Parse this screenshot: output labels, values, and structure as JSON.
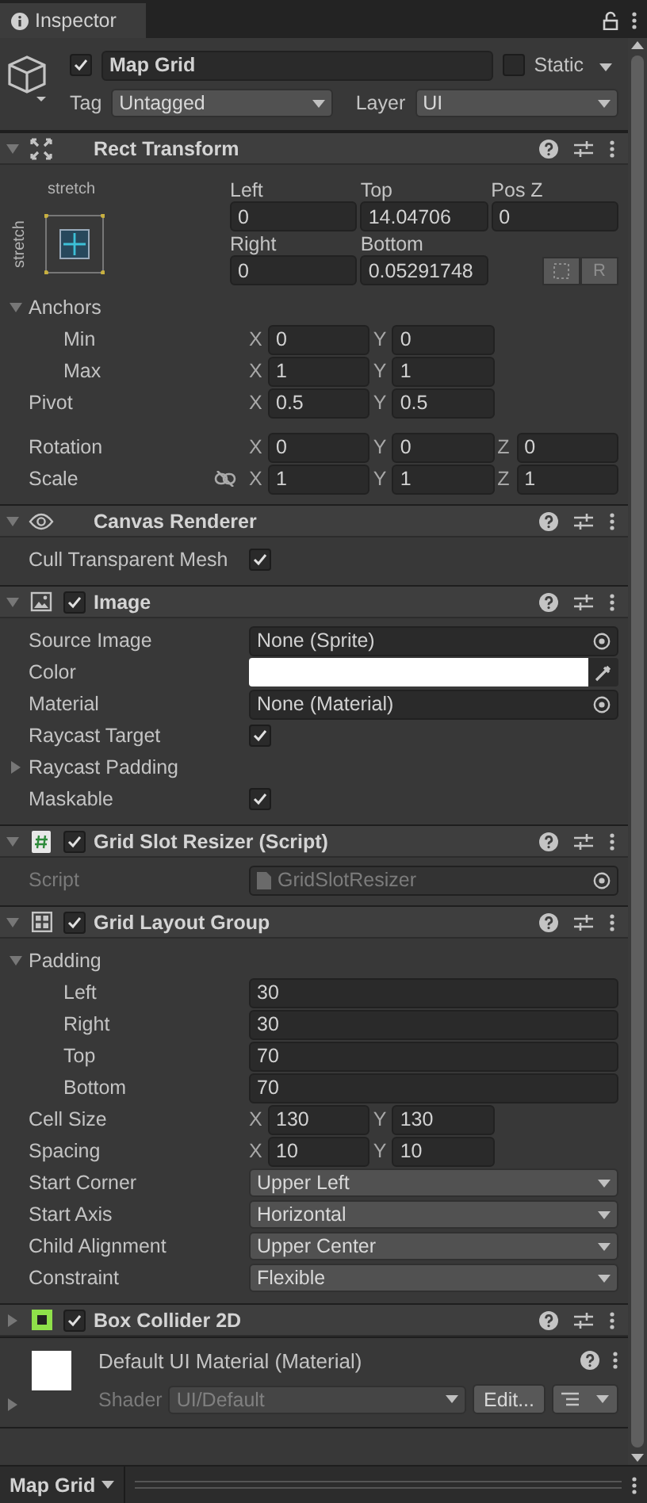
{
  "tab": {
    "label": "Inspector"
  },
  "object": {
    "active": true,
    "name": "Map Grid",
    "static": false,
    "static_label": "Static",
    "tag_label": "Tag",
    "tag": "Untagged",
    "layer_label": "Layer",
    "layer": "UI"
  },
  "components": [
    {
      "title": "Rect Transform",
      "kind": "rect",
      "expanded": true,
      "rect": {
        "preset_h": "stretch",
        "preset_v": "stretch",
        "fields": [
          {
            "label": "Left",
            "value": "0"
          },
          {
            "label": "Top",
            "value": "14.04706"
          },
          {
            "label": "Pos Z",
            "value": "0"
          },
          {
            "label": "Right",
            "value": "0"
          },
          {
            "label": "Bottom",
            "value": "0.05291748"
          }
        ],
        "raw_button": "R"
      },
      "rows": [
        {
          "kind": "foldout",
          "label": "Anchors",
          "expanded": true,
          "children": [
            {
              "kind": "vector",
              "label": "Min",
              "fields": [
                {
                  "axis": "X",
                  "value": "0"
                },
                {
                  "axis": "Y",
                  "value": "0"
                }
              ]
            },
            {
              "kind": "vector",
              "label": "Max",
              "fields": [
                {
                  "axis": "X",
                  "value": "1"
                },
                {
                  "axis": "Y",
                  "value": "1"
                }
              ]
            }
          ]
        },
        {
          "kind": "vector",
          "label": "Pivot",
          "fields": [
            {
              "axis": "X",
              "value": "0.5"
            },
            {
              "axis": "Y",
              "value": "0.5"
            }
          ]
        }
      ],
      "transform_rows": [
        {
          "kind": "vector",
          "label": "Rotation",
          "fields": [
            {
              "axis": "X",
              "value": "0"
            },
            {
              "axis": "Y",
              "value": "0"
            },
            {
              "axis": "Z",
              "value": "0"
            }
          ]
        },
        {
          "kind": "vector",
          "label": "Scale",
          "proportions_locked": false,
          "fields": [
            {
              "axis": "X",
              "value": "1"
            },
            {
              "axis": "Y",
              "value": "1"
            },
            {
              "axis": "Z",
              "value": "1"
            }
          ]
        }
      ]
    },
    {
      "title": "Canvas Renderer",
      "kind": "eye",
      "expanded": true,
      "rows": [
        {
          "kind": "checkbox",
          "label": "Cull Transparent Mesh",
          "checked": true
        }
      ]
    },
    {
      "title": "Image",
      "kind": "image",
      "enabled": true,
      "expanded": true,
      "rows": [
        {
          "kind": "object",
          "label": "Source Image",
          "value": "None (Sprite)"
        },
        {
          "kind": "color",
          "label": "Color",
          "color": "#ffffff"
        },
        {
          "kind": "object",
          "label": "Material",
          "value": "None (Material)"
        },
        {
          "kind": "checkbox",
          "label": "Raycast Target",
          "checked": true
        },
        {
          "kind": "foldout",
          "label": "Raycast Padding",
          "expanded": false
        },
        {
          "kind": "checkbox",
          "label": "Maskable",
          "checked": true
        }
      ]
    },
    {
      "title": "Grid Slot Resizer (Script)",
      "kind": "script",
      "enabled": true,
      "expanded": true,
      "rows": [
        {
          "kind": "object",
          "label": "Script",
          "value": "GridSlotResizer",
          "disabled": true,
          "file": true
        }
      ]
    },
    {
      "title": "Grid Layout Group",
      "kind": "grid",
      "enabled": true,
      "expanded": true,
      "rows": [
        {
          "kind": "foldout",
          "label": "Padding",
          "expanded": true,
          "children": [
            {
              "kind": "number",
              "label": "Left",
              "value": "30"
            },
            {
              "kind": "number",
              "label": "Right",
              "value": "30"
            },
            {
              "kind": "number",
              "label": "Top",
              "value": "70"
            },
            {
              "kind": "number",
              "label": "Bottom",
              "value": "70"
            }
          ]
        },
        {
          "kind": "vector",
          "label": "Cell Size",
          "fields": [
            {
              "axis": "X",
              "value": "130"
            },
            {
              "axis": "Y",
              "value": "130"
            }
          ]
        },
        {
          "kind": "vector",
          "label": "Spacing",
          "fields": [
            {
              "axis": "X",
              "value": "10"
            },
            {
              "axis": "Y",
              "value": "10"
            }
          ]
        },
        {
          "kind": "dropdown",
          "label": "Start Corner",
          "value": "Upper Left"
        },
        {
          "kind": "dropdown",
          "label": "Start Axis",
          "value": "Horizontal"
        },
        {
          "kind": "dropdown",
          "label": "Child Alignment",
          "value": "Upper Center"
        },
        {
          "kind": "dropdown",
          "label": "Constraint",
          "value": "Flexible"
        }
      ]
    },
    {
      "title": "Box Collider 2D",
      "kind": "collider",
      "enabled": true,
      "expanded": false
    }
  ],
  "material": {
    "name": "Default UI Material (Material)",
    "expanded": false,
    "shader_label": "Shader",
    "shader": "UI/Default",
    "edit_button": "Edit..."
  },
  "bottom_bar": {
    "label": "Map Grid"
  }
}
